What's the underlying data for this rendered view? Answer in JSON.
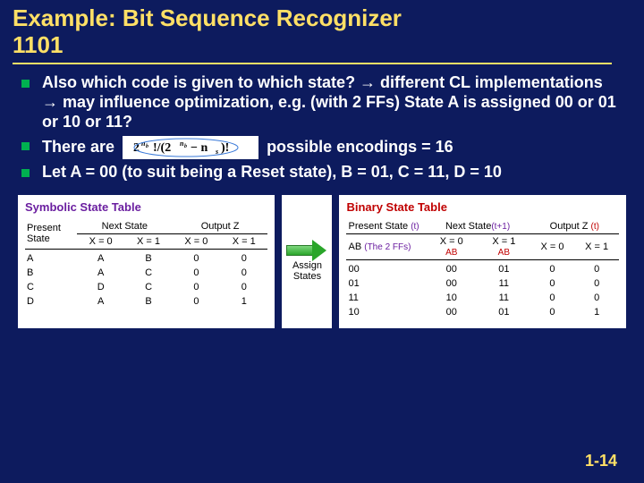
{
  "title_line1": "Example: Bit Sequence Recognizer",
  "title_line2": "1101",
  "bullets": {
    "b1": "Also which code is given to which state? → different CL implementations → may influence optimization, e.g. (with 2 FFs) State A is assigned 00 or 01 or 10 or 11?",
    "b2a": "There are ",
    "b2b": " possible encodings = 16",
    "b3": "Let A = 00 (to suit being a Reset state), B = 01, C = 11, D = 10",
    "formula_alt": "2^{n_b}! / (2^{n_b} - n_s)!"
  },
  "symbolic_table": {
    "title": "Symbolic State Table",
    "col_present": "Present State",
    "col_next": "Next State",
    "col_out": "Output Z",
    "sub_x0": "X = 0",
    "sub_x1": "X = 1",
    "rows": [
      {
        "s": "A",
        "n0": "A",
        "n1": "B",
        "z0": "0",
        "z1": "0"
      },
      {
        "s": "B",
        "n0": "A",
        "n1": "C",
        "z0": "0",
        "z1": "0"
      },
      {
        "s": "C",
        "n0": "D",
        "n1": "C",
        "z0": "0",
        "z1": "0"
      },
      {
        "s": "D",
        "n0": "A",
        "n1": "B",
        "z0": "0",
        "z1": "1"
      }
    ]
  },
  "arrow_label_1": "Assign",
  "arrow_label_2": "States",
  "binary_table": {
    "title": "Binary State Table",
    "col_present": "Present State",
    "ps_note": "(t)",
    "ps_sub": "AB",
    "ps_sub_note": "(The 2 FFs)",
    "col_next": "Next State",
    "ns_note": "(t+1)",
    "col_out": "Output Z",
    "out_note": "(t)",
    "sub_x0": "X = 0",
    "sub_x1": "X = 1",
    "sub_ab": "AB",
    "rows": [
      {
        "s": "00",
        "n0": "00",
        "n1": "01",
        "z0": "0",
        "z1": "0"
      },
      {
        "s": "01",
        "n0": "00",
        "n1": "11",
        "z0": "0",
        "z1": "0"
      },
      {
        "s": "11",
        "n0": "10",
        "n1": "11",
        "z0": "0",
        "z1": "0"
      },
      {
        "s": "10",
        "n0": "00",
        "n1": "01",
        "z0": "0",
        "z1": "1"
      }
    ]
  },
  "page_number": "1-14"
}
